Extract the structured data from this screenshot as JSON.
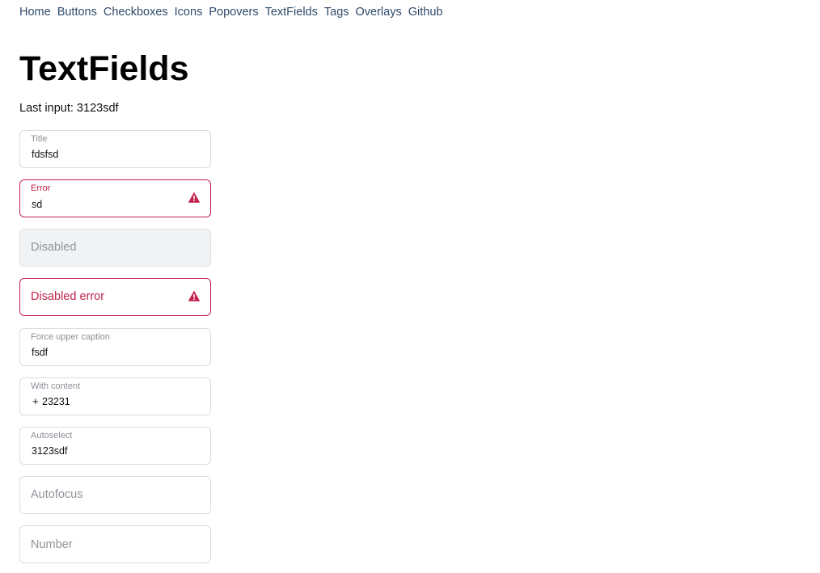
{
  "nav": {
    "items": [
      {
        "label": "Home"
      },
      {
        "label": "Buttons"
      },
      {
        "label": "Checkboxes"
      },
      {
        "label": "Icons"
      },
      {
        "label": "Popovers"
      },
      {
        "label": "TextFields"
      },
      {
        "label": "Tags"
      },
      {
        "label": "Overlays"
      },
      {
        "label": "Github"
      }
    ]
  },
  "page": {
    "title": "TextFields",
    "last_input": "Last input: 3123sdf"
  },
  "colors": {
    "link": "#2f4a6b",
    "error": "#c2224c",
    "border": "#dadce0",
    "disabled_bg": "#f1f2f4"
  },
  "fields": {
    "title": {
      "caption": "Title",
      "value": "fdsfsd"
    },
    "error": {
      "caption": "Error",
      "value": "sd",
      "icon": "warning-icon"
    },
    "disabled": {
      "placeholder": "Disabled"
    },
    "disabled_error": {
      "placeholder": "Disabled error",
      "icon": "warning-icon"
    },
    "force_upper": {
      "caption": "Force upper caption",
      "value": "fsdf"
    },
    "with_content": {
      "caption": "With content",
      "prefix": "+",
      "value": "23231"
    },
    "autoselect": {
      "caption": "Autoselect",
      "value": "3123sdf"
    },
    "autofocus": {
      "placeholder": "Autofocus"
    },
    "number": {
      "placeholder": "Number"
    }
  }
}
